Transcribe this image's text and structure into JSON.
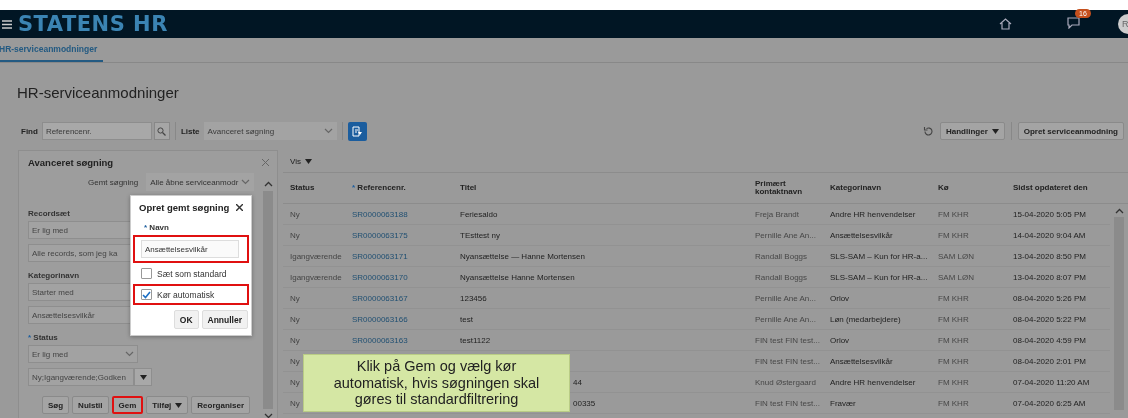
{
  "header": {
    "logo": "STATENS HR",
    "notification_count": "16",
    "avatar_initials": "R"
  },
  "tabs": [
    {
      "label": "HR-serviceanmodninger",
      "selected": true
    }
  ],
  "page_title": "HR-serviceanmodninger",
  "toolbar": {
    "find_label": "Find",
    "find_placeholder": "Referencenr.",
    "list_label": "Liste",
    "list_value": "Avanceret søgning",
    "actions_button": "Handlinger",
    "create_button": "Opret serviceanmodning"
  },
  "advanced_search": {
    "title": "Avanceret søgning",
    "saved_search_label": "Gemt søgning",
    "saved_search_value": "Alle åbne serviceanmodr",
    "items": [
      {
        "kind": "label",
        "text": "Recordsæt"
      },
      {
        "kind": "field",
        "text": "Er lig med"
      },
      {
        "kind": "field",
        "text": "Alle records, som jeg ka"
      },
      {
        "kind": "label",
        "text": "Kategorinavn"
      },
      {
        "kind": "field",
        "text": "Starter med"
      },
      {
        "kind": "field",
        "text": "Ansættelsesvilkår"
      },
      {
        "kind": "label",
        "text": "Status",
        "marker": "*"
      },
      {
        "kind": "select",
        "text": "Er lig med"
      },
      {
        "kind": "multiselect",
        "text": "Ny;Igangværende;Godken"
      }
    ],
    "buttons": [
      {
        "label": "Søg",
        "dropdown": false,
        "highlighted": false
      },
      {
        "label": "Nulstil",
        "dropdown": false,
        "highlighted": false
      },
      {
        "label": "Gem",
        "dropdown": false,
        "highlighted": true
      },
      {
        "label": "Tilføj",
        "dropdown": true,
        "highlighted": false
      },
      {
        "label": "Reorganiser",
        "dropdown": false,
        "highlighted": false
      }
    ]
  },
  "dialog": {
    "title": "Opret gemt søgning",
    "name_label": "Navn",
    "name_marker": "*",
    "name_value": "Ansættelsesvilkår",
    "name_highlighted": true,
    "checkboxes": [
      {
        "label": "Sæt som standard",
        "checked": false,
        "highlighted": false
      },
      {
        "label": "Kør automatisk",
        "checked": true,
        "highlighted": true
      }
    ],
    "buttons": [
      "OK",
      "Annuller"
    ]
  },
  "table": {
    "view_menu": "Vis",
    "columns": [
      {
        "label": "Status"
      },
      {
        "label": "Referencenr.",
        "marker": "*"
      },
      {
        "label": "Titel"
      },
      {
        "label": "Primært kontaktnavn"
      },
      {
        "label": "Kategorinavn"
      },
      {
        "label": "Kø"
      },
      {
        "label": "Sidst opdateret den"
      }
    ],
    "rows": [
      {
        "status": "Ny",
        "ref": "SR0000063188",
        "title": "Feriesaldo",
        "contact": "Freja Brandt",
        "category": "Andre HR henvendelser",
        "queue": "FM KHR",
        "updated": "15-04-2020 5:05 PM"
      },
      {
        "status": "Ny",
        "ref": "SR0000063175",
        "title": "TEsttest ny",
        "contact": "Pernille Ane An...",
        "category": "Ansættelsesvilkår",
        "queue": "FM KHR",
        "updated": "14-04-2020 9:04 AM"
      },
      {
        "status": "Igangværende",
        "ref": "SR0000063171",
        "title": "Nyansættelse — Hanne Mortensen",
        "contact": "Randall Boggs",
        "category": "SLS-SAM – Kun for HR-a...",
        "queue": "SAM LØN",
        "updated": "13-04-2020 8:50 PM"
      },
      {
        "status": "Igangværende",
        "ref": "SR0000063170",
        "title": "Nyansættelse Hanne Mortensen",
        "contact": "Randall Boggs",
        "category": "SLS-SAM – Kun for HR-a...",
        "queue": "SAM LØN",
        "updated": "13-04-2020 8:07 PM"
      },
      {
        "status": "Ny",
        "ref": "SR0000063167",
        "title": "123456",
        "contact": "Pernille Ane An...",
        "category": "Orlov",
        "queue": "FM KHR",
        "updated": "08-04-2020 5:26 PM"
      },
      {
        "status": "Ny",
        "ref": "SR0000063166",
        "title": "test",
        "contact": "Pernille Ane An...",
        "category": "Løn (medarbejdere)",
        "queue": "FM KHR",
        "updated": "08-04-2020 5:22 PM"
      },
      {
        "status": "Ny",
        "ref": "SR0000063163",
        "title": "test1122",
        "contact": "FIN test FIN test...",
        "category": "Orlov",
        "queue": "FM KHR",
        "updated": "08-04-2020 4:59 PM"
      },
      {
        "status": "Ny",
        "contact": "FIN test FIN test...",
        "category": "Ansættelsesvilkår",
        "queue": "FM KHR",
        "updated": "08-04-2020 2:01 PM"
      },
      {
        "status": "Ny",
        "title_fragment": "44",
        "contact": "Knud Østergaard",
        "category": "Andre HR henvendelser",
        "queue": "FM KHR",
        "updated": "07-04-2020 11:20 AM"
      },
      {
        "status": "Ny",
        "title_fragment": "00335",
        "contact": "FIN test FIN test...",
        "category": "Fravær",
        "queue": "FM KHR",
        "updated": "07-04-2020 6:25 AM"
      }
    ]
  },
  "callout": {
    "text": "Klik på Gem og vælg kør automatisk, hvis søgningen skal gøres til standardfiltrering"
  }
}
